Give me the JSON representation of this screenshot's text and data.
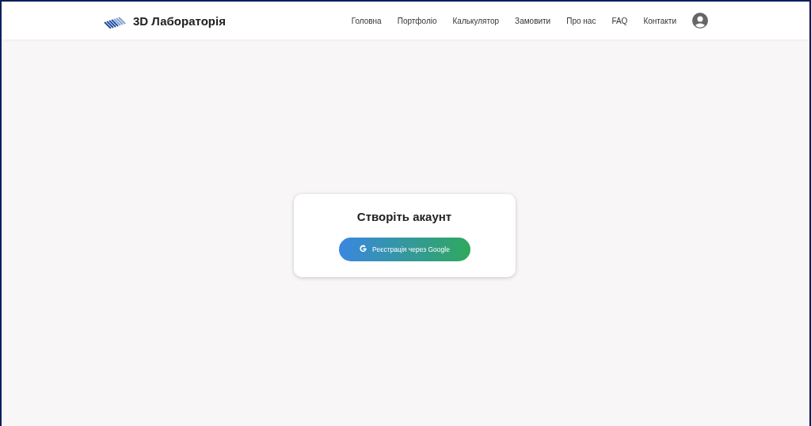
{
  "header": {
    "logo": "3D Лабораторія",
    "nav": [
      "Головна",
      "Портфоліо",
      "Калькулятор",
      "Замовити",
      "Про нас",
      "FAQ",
      "Контакти"
    ]
  },
  "card": {
    "title": "Створіть акаунт",
    "button": "Реєстрація через Google"
  }
}
